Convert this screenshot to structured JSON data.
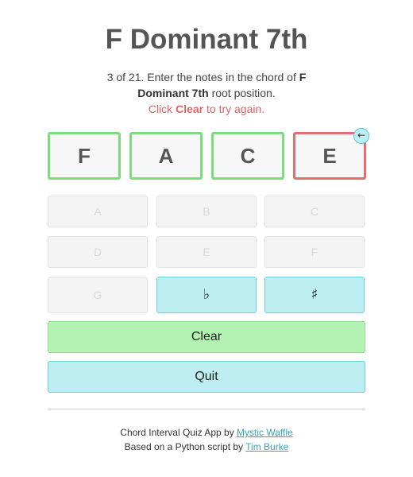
{
  "header": {
    "title": "F Dominant 7th"
  },
  "instructions": {
    "progress": "3 of 21.",
    "text_before": " Enter the notes in the chord of ",
    "chord_name": "F Dominant 7th",
    "text_after": " root position.",
    "retry_prefix": "Click ",
    "retry_keyword": "Clear",
    "retry_suffix": " to try again."
  },
  "answers": [
    {
      "note": "F",
      "status": "correct"
    },
    {
      "note": "A",
      "status": "correct"
    },
    {
      "note": "C",
      "status": "correct"
    },
    {
      "note": "E",
      "status": "wrong"
    }
  ],
  "back_button": {
    "label": "←"
  },
  "note_buttons": {
    "A": "A",
    "B": "B",
    "C": "C",
    "D": "D",
    "E": "E",
    "F": "F",
    "G": "G",
    "flat": "♭",
    "sharp": "♯"
  },
  "actions": {
    "clear_label": "Clear",
    "quit_label": "Quit"
  },
  "footer": {
    "line1_prefix": "Chord Interval Quiz App by ",
    "line1_link": "Mystic Waffle",
    "line2_prefix": "Based on a Python script by ",
    "line2_link": "Tim Burke"
  },
  "colors": {
    "correct_border": "#7ddd7d",
    "wrong_border": "#e07070",
    "accent_cyan": "#bdeef1",
    "clear_green": "#b4f2b4",
    "link": "#3aa6b8",
    "retry_red": "#e06464"
  }
}
